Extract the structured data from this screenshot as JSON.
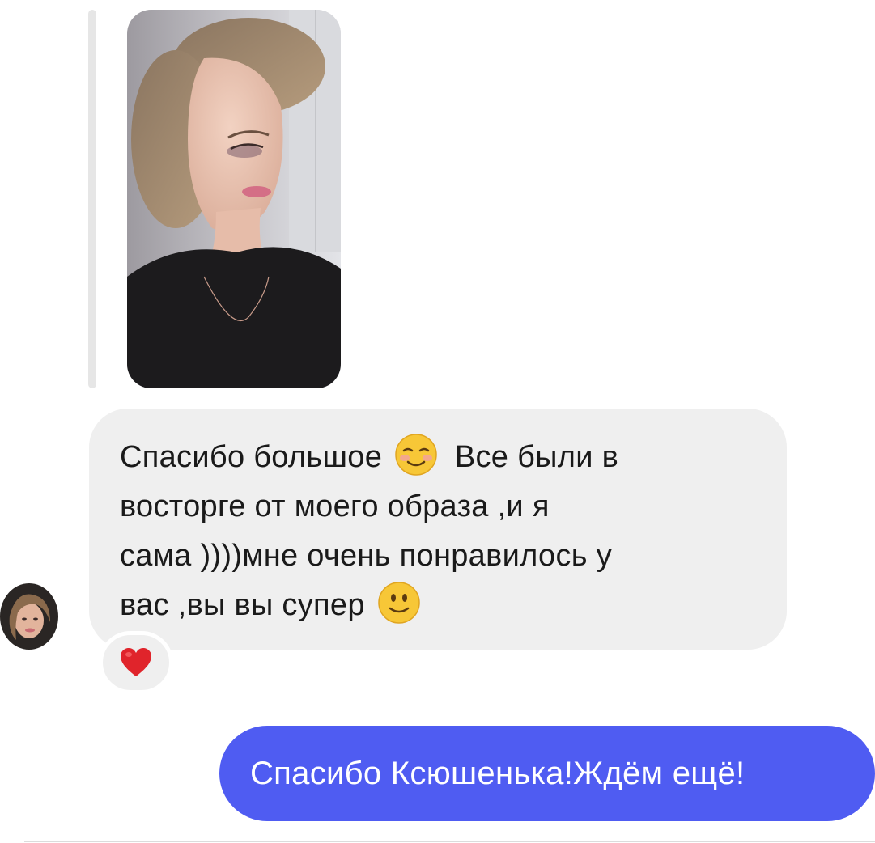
{
  "thread": {
    "incoming_message": {
      "parts": [
        "Спасибо большое",
        "Все были в",
        "восторге от моего образа ,и я",
        "сама ))))мне очень понравилось у",
        "вас ,вы вы супер"
      ],
      "emojis": [
        "smiling-face-icon",
        "slightly-smiling-face-icon"
      ],
      "reaction": "heart-icon"
    },
    "outgoing_message": {
      "text": "Спасибо Ксюшенька!Ждём ещё!"
    }
  },
  "colors": {
    "incoming_bubble": "#efefef",
    "outgoing_bubble": "#4f5cf2",
    "reply_bar": "#e6e6e6",
    "heart": "#e0242b"
  }
}
